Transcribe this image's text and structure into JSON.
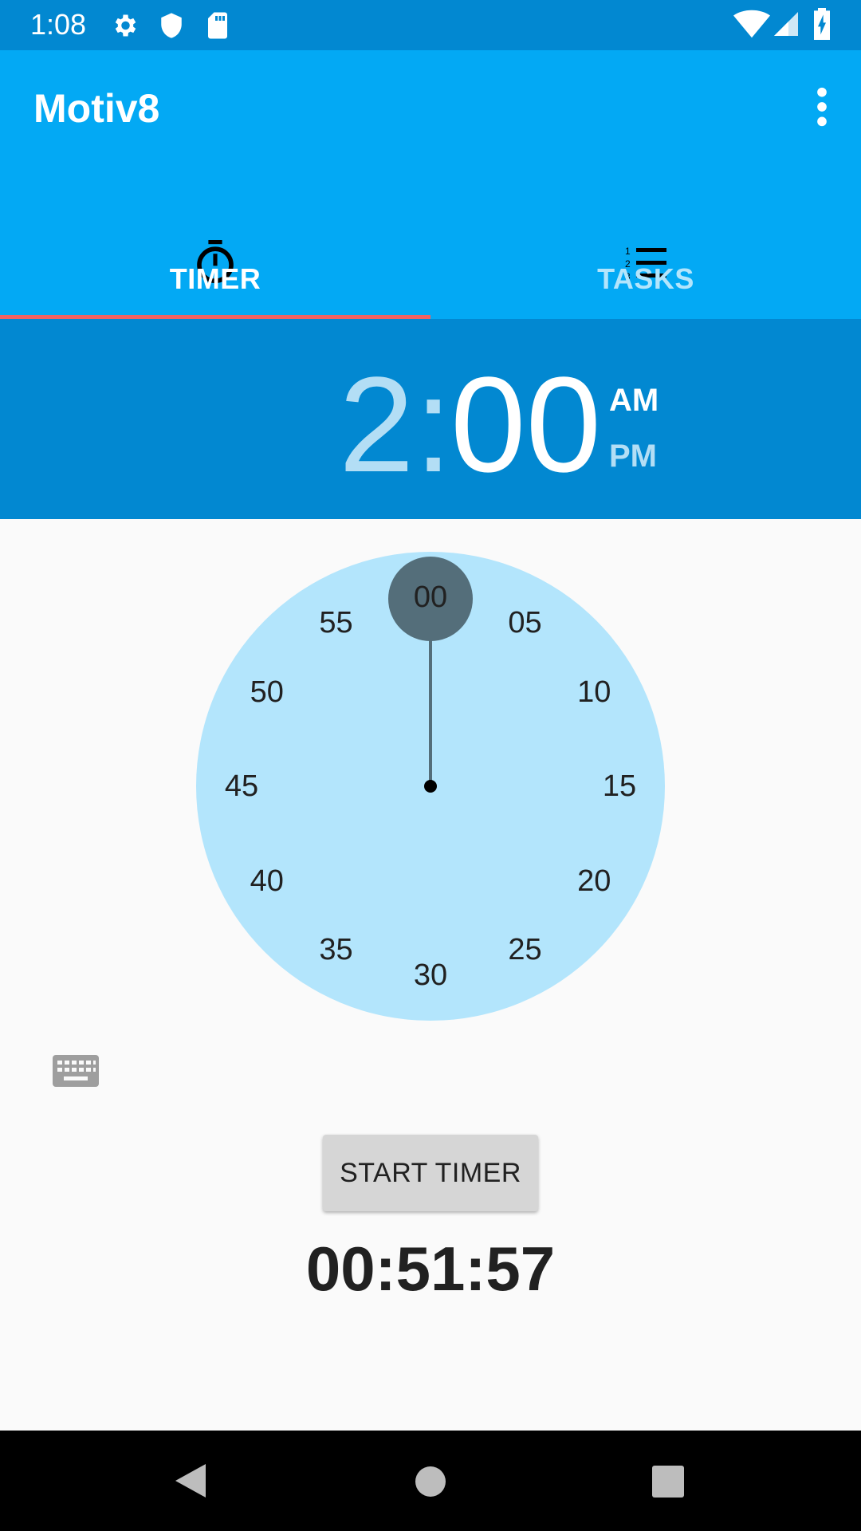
{
  "status_bar": {
    "time": "1:08",
    "icons": [
      "settings-icon",
      "shield-icon",
      "sd-card-icon",
      "wifi-icon",
      "signal-icon",
      "battery-charging-icon"
    ]
  },
  "app_bar": {
    "title": "Motiv8",
    "menu_icon": "more-vert-icon"
  },
  "tabs": [
    {
      "label": "TIMER",
      "icon": "stopwatch-icon",
      "selected": true
    },
    {
      "label": "TASKS",
      "icon": "numbered-list-icon",
      "selected": false
    }
  ],
  "time_picker": {
    "hour": "2",
    "separator": ":",
    "minute": "00",
    "am_label": "AM",
    "pm_label": "PM",
    "selected_period": "AM",
    "dial_numbers": [
      "00",
      "05",
      "10",
      "15",
      "20",
      "25",
      "30",
      "35",
      "40",
      "45",
      "50",
      "55"
    ],
    "selected_value": "00"
  },
  "keyboard_icon": "keyboard-icon",
  "start_button": {
    "label": "START TIMER"
  },
  "countdown": {
    "value": "00:51:57"
  },
  "colors": {
    "status_bar": "#0288d1",
    "app_bar": "#03a9f4",
    "tab_indicator": "#f06262",
    "dial_background": "#b3e5fc",
    "dial_selector": "#546e7a"
  },
  "nav_bar": {
    "icons": [
      "back-icon",
      "home-icon",
      "recents-icon"
    ]
  }
}
